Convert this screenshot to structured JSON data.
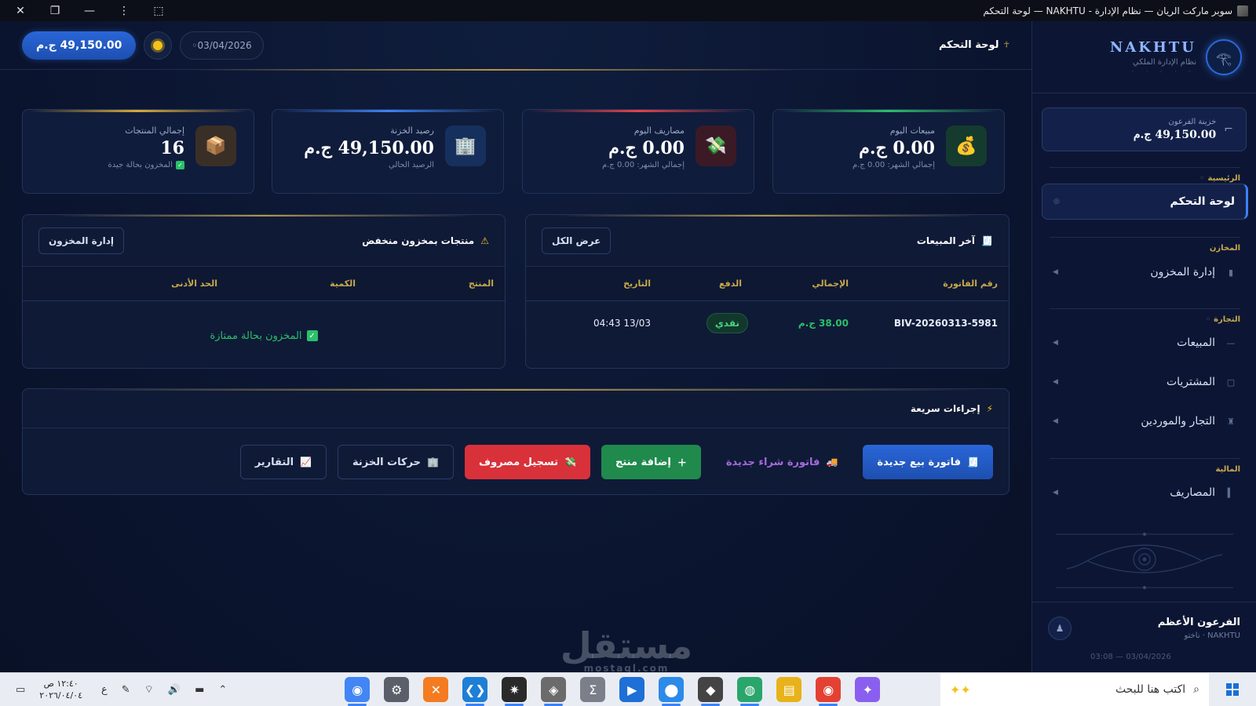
{
  "window": {
    "title": "سوبر ماركت الريان — نظام الإدارة - NAKHTU — لوحة التحكم"
  },
  "topbar": {
    "page_title": "لوحة التحكم",
    "date": "03/04/2026",
    "balance": "49,150.00 ج.م"
  },
  "stats": [
    {
      "label": "مبيعات اليوم",
      "value": "0.00 ج.م",
      "sub": "إجمالي الشهر: 0.00 ج.م",
      "icon": "money-bag-icon"
    },
    {
      "label": "مصاريف اليوم",
      "value": "0.00 ج.م",
      "sub": "إجمالي الشهر: 0.00 ج.م",
      "icon": "money-wings-icon"
    },
    {
      "label": "رصيد الخزنة",
      "value": "49,150.00 ج.م",
      "sub": "الرصيد الحالي",
      "icon": "building-icon"
    },
    {
      "label": "إجمالي المنتجات",
      "value": "16",
      "sub": "المخزون بحالة جيدة",
      "icon": "package-icon"
    }
  ],
  "recent_sales": {
    "title": "آخر المبيعات",
    "button": "عرض الكل",
    "columns": [
      "رقم الفاتورة",
      "الإجمالي",
      "الدفع",
      "التاريخ"
    ],
    "rows": [
      {
        "invoice": "BIV-20260313-5981",
        "total": "38.00 ج.م",
        "payment": "نقدي",
        "date": "13/03 04:43"
      }
    ]
  },
  "low_stock": {
    "title": "منتجات بمخزون منخفض",
    "button": "إدارة المخزون",
    "columns": [
      "المنتج",
      "الكمية",
      "الحد الأدنى"
    ],
    "empty": "المخزون بحالة ممتازة"
  },
  "quick_actions": {
    "title": "إجراءات سريعة",
    "buttons": [
      "فاتورة بيع جديدة",
      "فاتورة شراء جديدة",
      "إضافة منتج",
      "تسجيل مصروف",
      "حركات الخزنة",
      "التقارير"
    ]
  },
  "sidebar": {
    "brand": "NAKHTU",
    "brand_sub": "نظام الإدارة الملكي",
    "treasury_label": "خزينة الفرعون",
    "treasury_value": "49,150.00 ج.م",
    "sections": {
      "main": "الرئيسية",
      "stores": "المخازن",
      "trade": "التجارة",
      "finance": "المالية"
    },
    "items": {
      "dashboard": "لوحة التحكم",
      "inventory": "إدارة المخزون",
      "sales": "المبيعات",
      "purchases": "المشتريات",
      "suppliers": "التجار والموردين",
      "expenses": "المصاريف"
    },
    "user_name": "الفرعون الأعظم",
    "user_role": "NAKHTU · ناختو",
    "stamp": "03/04/2026 — 03:08"
  },
  "watermark": {
    "main": "مستقل",
    "sub": "mostaql.com"
  },
  "taskbar": {
    "search_placeholder": "اكتب هنا للبحث",
    "time": "١٢:٤٠ ص",
    "date": "٢٠٢٦/٠٤/٠٤",
    "lang": "ع"
  },
  "colors": {
    "accent": "#2a66d8",
    "gold": "#c9a94a",
    "success": "#2bbf6a",
    "danger": "#d8313a",
    "background": "#0a1226"
  }
}
